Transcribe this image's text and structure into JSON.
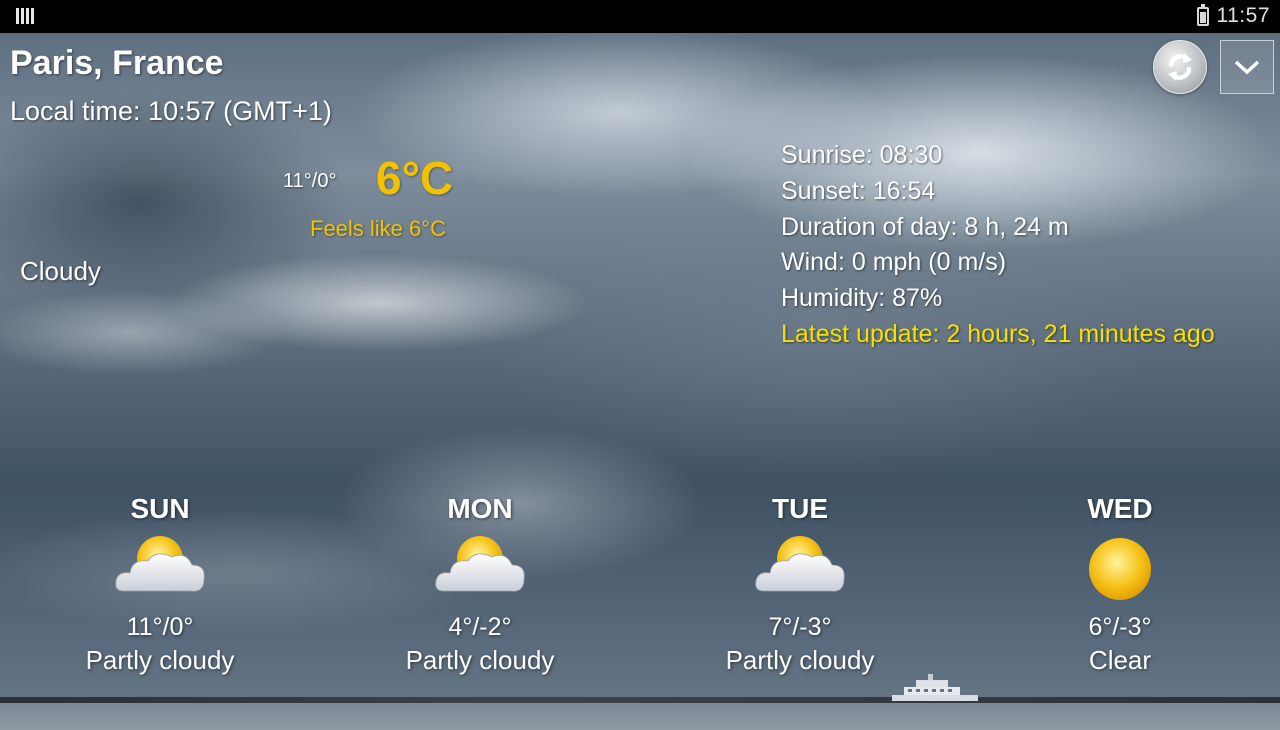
{
  "status_bar": {
    "time": "11:57",
    "left_icon": "barcode-icon",
    "battery_icon": "battery-charging-icon"
  },
  "header": {
    "city": "Paris, France",
    "local_time": "Local time: 10:57 (GMT+1)",
    "refresh_icon": "refresh-icon",
    "menu_icon": "chevron-down-icon"
  },
  "current": {
    "range": "11°/0°",
    "temperature": "6°C",
    "feels_like": "Feels like 6°C",
    "condition": "Cloudy"
  },
  "details": {
    "sunrise": "Sunrise: 08:30",
    "sunset": "Sunset: 16:54",
    "duration": "Duration of day: 8 h, 24 m",
    "wind": "Wind: 0 mph (0 m/s)",
    "humidity": "Humidity: 87%",
    "latest_update": "Latest update: 2 hours, 21 minutes ago"
  },
  "forecast": [
    {
      "day": "SUN",
      "temps": "11°/0°",
      "desc": "Partly cloudy",
      "icon": "partly-cloudy-icon"
    },
    {
      "day": "MON",
      "temps": "4°/-2°",
      "desc": "Partly cloudy",
      "icon": "partly-cloudy-icon"
    },
    {
      "day": "TUE",
      "temps": "7°/-3°",
      "desc": "Partly cloudy",
      "icon": "partly-cloudy-icon"
    },
    {
      "day": "WED",
      "temps": "6°/-3°",
      "desc": "Clear",
      "icon": "sun-icon"
    }
  ],
  "colors": {
    "accent_yellow": "#f2c200",
    "update_yellow": "#f5e100",
    "text": "#ffffff",
    "status_bar": "#000000"
  }
}
